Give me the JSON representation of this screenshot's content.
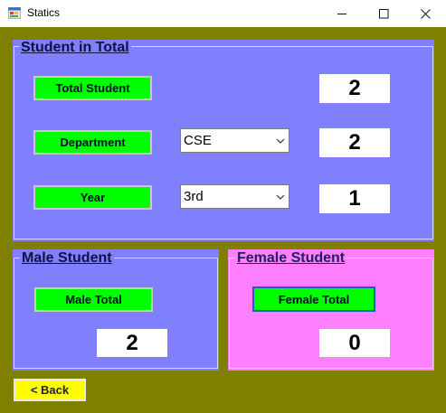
{
  "window": {
    "title": "Statics",
    "app_icon": "forms-app-icon",
    "minimize_symbol": "—",
    "maximize_symbol": "☐",
    "close_symbol": "✕"
  },
  "student_total": {
    "group_title": "Student in Total",
    "total_button": "Total Student",
    "total_value": "2",
    "department_button": "Department",
    "department_select": "CSE",
    "department_value": "2",
    "year_button": "Year",
    "year_select": "3rd",
    "year_value": "1"
  },
  "male": {
    "group_title": "Male Student",
    "button": "Male Total",
    "value": "2"
  },
  "female": {
    "group_title": "Female Student",
    "button": "Female Total",
    "value": "0"
  },
  "back_button": "<  Back",
  "colors": {
    "form_background": "#808000",
    "blue_panel": "#8080ff",
    "pink_panel": "#ff80ff",
    "green_button": "#00ff00",
    "back_button": "#ffff00"
  }
}
